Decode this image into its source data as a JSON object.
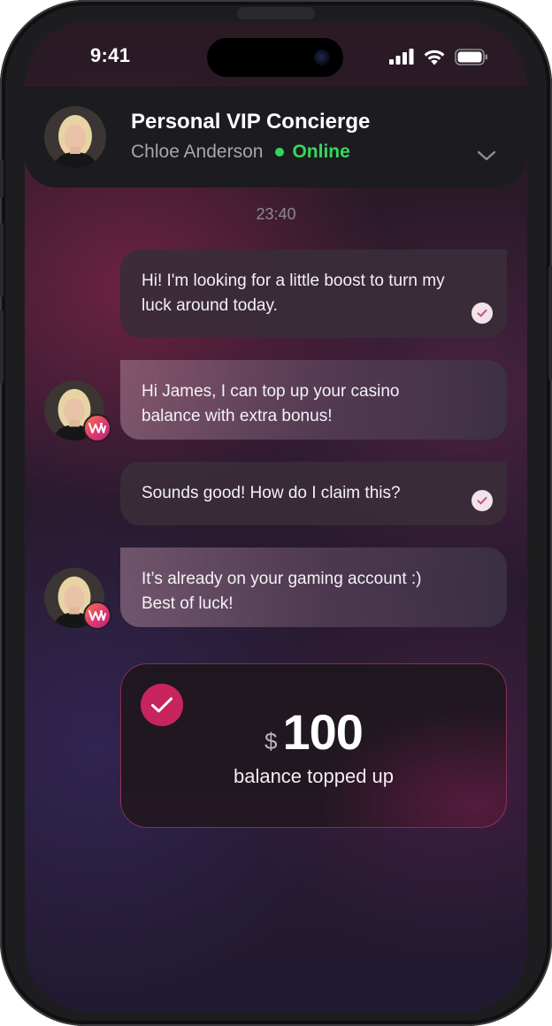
{
  "status_bar": {
    "time": "9:41"
  },
  "header": {
    "title": "Personal VIP Concierge",
    "agent_name": "Chloe Anderson",
    "status": "Online",
    "status_color": "#38d65f"
  },
  "chat": {
    "timestamp": "23:40",
    "messages": [
      {
        "direction": "outgoing",
        "text": "Hi! I'm looking for a little boost to turn my luck around today.",
        "read": true
      },
      {
        "direction": "incoming",
        "text": "Hi James, I can top up your casino balance with extra bonus!"
      },
      {
        "direction": "outgoing",
        "text": "Sounds good! How do I claim this?",
        "read": true
      },
      {
        "direction": "incoming",
        "text": "It’s already on your gaming account :) Best of luck!"
      }
    ]
  },
  "topup": {
    "currency": "$",
    "amount": "100",
    "label": "balance topped up",
    "accent_color": "#c8245e"
  },
  "icons": {
    "status": [
      "cellular-signal-icon",
      "wifi-icon",
      "battery-icon"
    ],
    "header": [
      "chevron-down-icon"
    ],
    "message": [
      "read-check-icon",
      "brand-badge-icon"
    ],
    "card": [
      "checkmark-icon"
    ]
  }
}
